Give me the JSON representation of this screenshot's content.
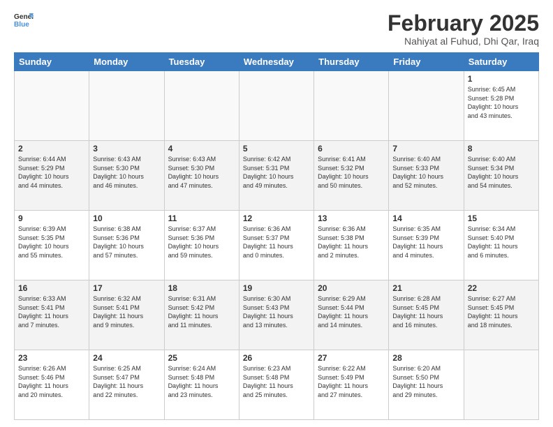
{
  "header": {
    "logo_general": "General",
    "logo_blue": "Blue",
    "title": "February 2025",
    "subtitle": "Nahiyat al Fuhud, Dhi Qar, Iraq"
  },
  "weekdays": [
    "Sunday",
    "Monday",
    "Tuesday",
    "Wednesday",
    "Thursday",
    "Friday",
    "Saturday"
  ],
  "weeks": [
    [
      {
        "day": "",
        "info": ""
      },
      {
        "day": "",
        "info": ""
      },
      {
        "day": "",
        "info": ""
      },
      {
        "day": "",
        "info": ""
      },
      {
        "day": "",
        "info": ""
      },
      {
        "day": "",
        "info": ""
      },
      {
        "day": "1",
        "info": "Sunrise: 6:45 AM\nSunset: 5:28 PM\nDaylight: 10 hours\nand 43 minutes."
      }
    ],
    [
      {
        "day": "2",
        "info": "Sunrise: 6:44 AM\nSunset: 5:29 PM\nDaylight: 10 hours\nand 44 minutes."
      },
      {
        "day": "3",
        "info": "Sunrise: 6:43 AM\nSunset: 5:30 PM\nDaylight: 10 hours\nand 46 minutes."
      },
      {
        "day": "4",
        "info": "Sunrise: 6:43 AM\nSunset: 5:30 PM\nDaylight: 10 hours\nand 47 minutes."
      },
      {
        "day": "5",
        "info": "Sunrise: 6:42 AM\nSunset: 5:31 PM\nDaylight: 10 hours\nand 49 minutes."
      },
      {
        "day": "6",
        "info": "Sunrise: 6:41 AM\nSunset: 5:32 PM\nDaylight: 10 hours\nand 50 minutes."
      },
      {
        "day": "7",
        "info": "Sunrise: 6:40 AM\nSunset: 5:33 PM\nDaylight: 10 hours\nand 52 minutes."
      },
      {
        "day": "8",
        "info": "Sunrise: 6:40 AM\nSunset: 5:34 PM\nDaylight: 10 hours\nand 54 minutes."
      }
    ],
    [
      {
        "day": "9",
        "info": "Sunrise: 6:39 AM\nSunset: 5:35 PM\nDaylight: 10 hours\nand 55 minutes."
      },
      {
        "day": "10",
        "info": "Sunrise: 6:38 AM\nSunset: 5:36 PM\nDaylight: 10 hours\nand 57 minutes."
      },
      {
        "day": "11",
        "info": "Sunrise: 6:37 AM\nSunset: 5:36 PM\nDaylight: 10 hours\nand 59 minutes."
      },
      {
        "day": "12",
        "info": "Sunrise: 6:36 AM\nSunset: 5:37 PM\nDaylight: 11 hours\nand 0 minutes."
      },
      {
        "day": "13",
        "info": "Sunrise: 6:36 AM\nSunset: 5:38 PM\nDaylight: 11 hours\nand 2 minutes."
      },
      {
        "day": "14",
        "info": "Sunrise: 6:35 AM\nSunset: 5:39 PM\nDaylight: 11 hours\nand 4 minutes."
      },
      {
        "day": "15",
        "info": "Sunrise: 6:34 AM\nSunset: 5:40 PM\nDaylight: 11 hours\nand 6 minutes."
      }
    ],
    [
      {
        "day": "16",
        "info": "Sunrise: 6:33 AM\nSunset: 5:41 PM\nDaylight: 11 hours\nand 7 minutes."
      },
      {
        "day": "17",
        "info": "Sunrise: 6:32 AM\nSunset: 5:41 PM\nDaylight: 11 hours\nand 9 minutes."
      },
      {
        "day": "18",
        "info": "Sunrise: 6:31 AM\nSunset: 5:42 PM\nDaylight: 11 hours\nand 11 minutes."
      },
      {
        "day": "19",
        "info": "Sunrise: 6:30 AM\nSunset: 5:43 PM\nDaylight: 11 hours\nand 13 minutes."
      },
      {
        "day": "20",
        "info": "Sunrise: 6:29 AM\nSunset: 5:44 PM\nDaylight: 11 hours\nand 14 minutes."
      },
      {
        "day": "21",
        "info": "Sunrise: 6:28 AM\nSunset: 5:45 PM\nDaylight: 11 hours\nand 16 minutes."
      },
      {
        "day": "22",
        "info": "Sunrise: 6:27 AM\nSunset: 5:45 PM\nDaylight: 11 hours\nand 18 minutes."
      }
    ],
    [
      {
        "day": "23",
        "info": "Sunrise: 6:26 AM\nSunset: 5:46 PM\nDaylight: 11 hours\nand 20 minutes."
      },
      {
        "day": "24",
        "info": "Sunrise: 6:25 AM\nSunset: 5:47 PM\nDaylight: 11 hours\nand 22 minutes."
      },
      {
        "day": "25",
        "info": "Sunrise: 6:24 AM\nSunset: 5:48 PM\nDaylight: 11 hours\nand 23 minutes."
      },
      {
        "day": "26",
        "info": "Sunrise: 6:23 AM\nSunset: 5:48 PM\nDaylight: 11 hours\nand 25 minutes."
      },
      {
        "day": "27",
        "info": "Sunrise: 6:22 AM\nSunset: 5:49 PM\nDaylight: 11 hours\nand 27 minutes."
      },
      {
        "day": "28",
        "info": "Sunrise: 6:20 AM\nSunset: 5:50 PM\nDaylight: 11 hours\nand 29 minutes."
      },
      {
        "day": "",
        "info": ""
      }
    ]
  ]
}
